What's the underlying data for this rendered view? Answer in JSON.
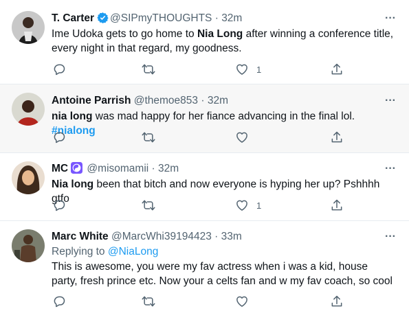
{
  "tweets": [
    {
      "name": "T. Carter",
      "verified": true,
      "handle": "@SIPmyTHOUGHTS",
      "time": "32m",
      "text_parts": [
        "Ime Udoka gets to go home to ",
        "Nia Long",
        " after winning a conference title, every night in that regard, my goodness."
      ],
      "like_count": "1"
    },
    {
      "name": "Antoine Parrish",
      "handle": "@themoe853",
      "time": "32m",
      "text_parts": [
        "nia long",
        " was mad happy for her fiance advancing in the final lol. ",
        "#nialong"
      ],
      "like_count": ""
    },
    {
      "name": "MC",
      "badge_icon": "yin-yang-icon",
      "handle": "@misomamii",
      "time": "32m",
      "text_parts": [
        "Nia long",
        " been that bitch and now everyone is hyping her up? Pshhhh gtfo"
      ],
      "like_count": "1"
    },
    {
      "name": "Marc White",
      "handle": "@MarcWhi39194423",
      "time": "33m",
      "replying_label": "Replying to ",
      "replying_handle": "@NiaLong",
      "text": "This is awesome, you were my fav actress when i was a kid, house party, fresh prince etc. Now your a celts fan and w my fav coach, so cool",
      "like_count": ""
    }
  ],
  "separator": "·",
  "more_glyph": "···",
  "colors": {
    "link": "#1d9bf0",
    "secondary": "#536471",
    "verified": "#1d9bf0",
    "badge": "#7856ff"
  }
}
